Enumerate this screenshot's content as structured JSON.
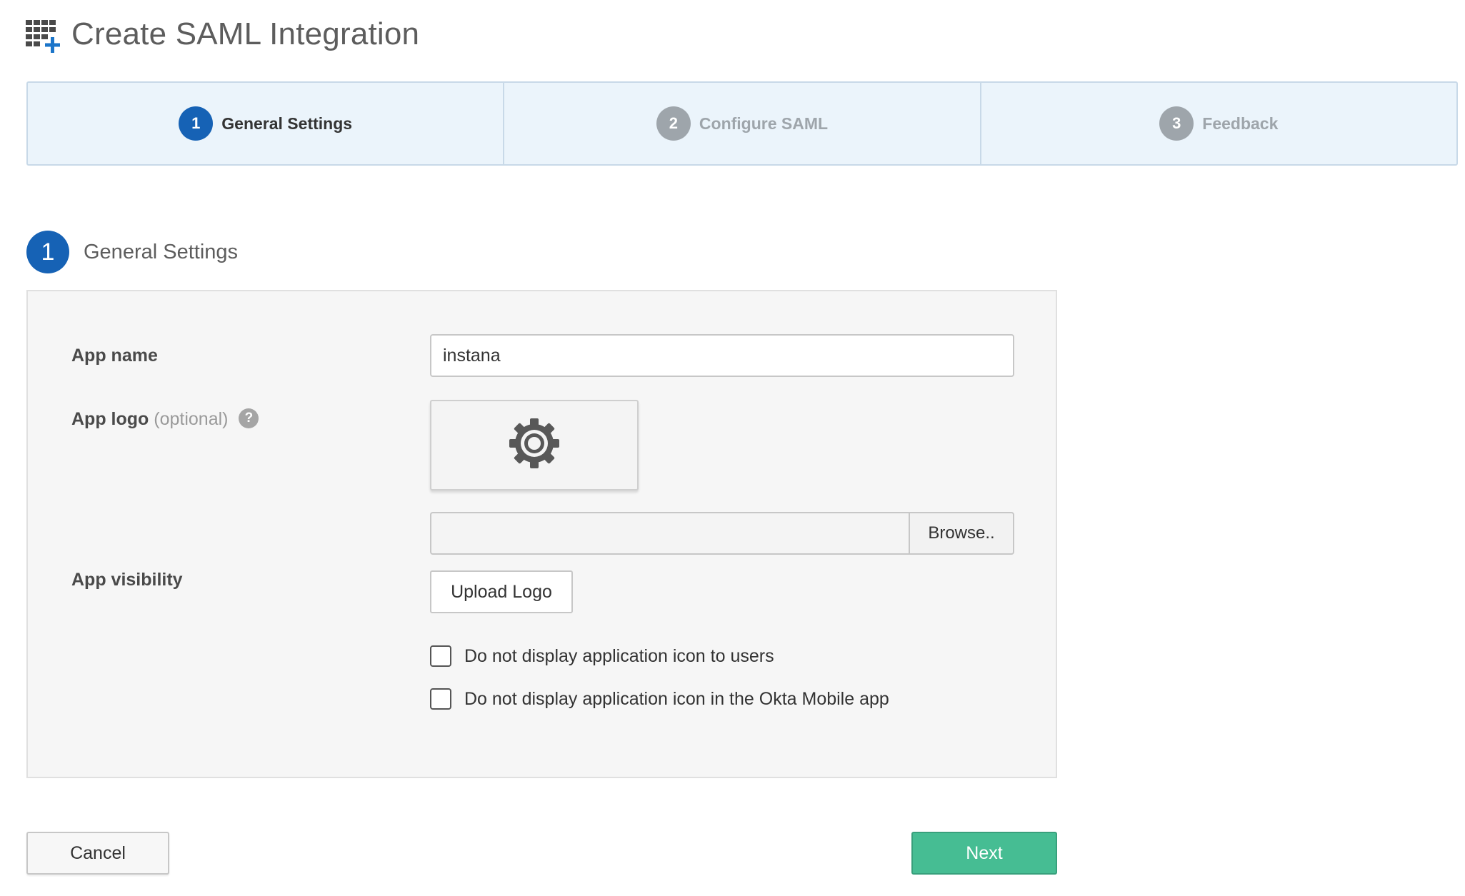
{
  "header": {
    "title": "Create SAML Integration",
    "icon": "grid-add-icon"
  },
  "wizard": {
    "steps": [
      {
        "number": "1",
        "label": "General Settings",
        "state": "active"
      },
      {
        "number": "2",
        "label": "Configure SAML",
        "state": "inactive"
      },
      {
        "number": "3",
        "label": "Feedback",
        "state": "inactive"
      }
    ]
  },
  "section": {
    "number": "1",
    "title": "General Settings"
  },
  "form": {
    "app_name": {
      "label": "App name",
      "value": "instana"
    },
    "app_logo": {
      "label": "App logo",
      "optional": "(optional)",
      "help": "?",
      "preview_icon": "gear-icon",
      "file_path": "",
      "browse_label": "Browse..",
      "upload_label": "Upload Logo"
    },
    "app_visibility": {
      "label": "App visibility",
      "options": [
        {
          "label": "Do not display application icon to users",
          "checked": false
        },
        {
          "label": "Do not display application icon in the Okta Mobile app",
          "checked": false
        }
      ]
    }
  },
  "footer": {
    "cancel_label": "Cancel",
    "next_label": "Next"
  },
  "colors": {
    "accent_blue": "#1662b5",
    "step_inactive": "#9ea5ab",
    "wizard_bg": "#ebf4fb",
    "next_green": "#46bd93"
  }
}
